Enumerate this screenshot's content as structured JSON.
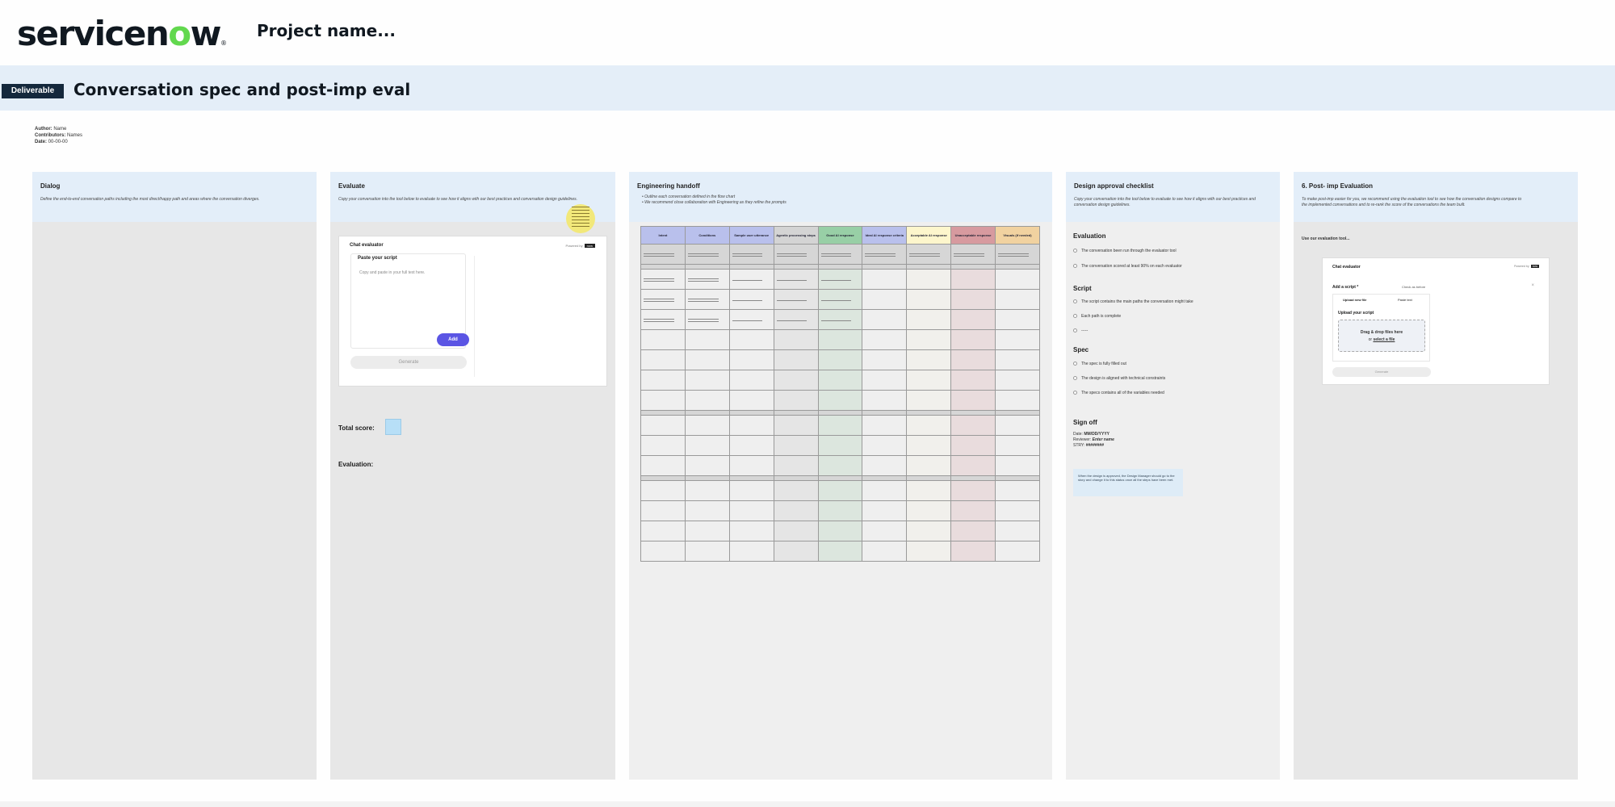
{
  "header": {
    "logo_text_a": "servicen",
    "logo_text_o": "o",
    "logo_text_b": "w",
    "logo_reg": "®",
    "project_name": "Project name..."
  },
  "deliverable": {
    "badge": "Deliverable",
    "title": "Conversation spec and post-imp eval"
  },
  "meta": {
    "author_label": "Author:",
    "author_value": " Name",
    "contributors_label": "Contributors:",
    "contributors_value": " Names",
    "date_label": "Date:",
    "date_value": " 00-00-00"
  },
  "columns": {
    "dialog": {
      "title": "Dialog",
      "desc": "Define the end-to-end conversation paths including the most direct/happy path and areas where the conversation diverges."
    },
    "evaluate": {
      "title": "Evaluate",
      "desc": "Copy your conversation into the tool below to evaluate to see how it aligns with our best practices and conversation design guidelines.",
      "card_title": "Chat evaluator",
      "card_right_text": "Powered by",
      "card_right_badge": "now",
      "paste_label": "Paste your script",
      "paste_placeholder": "Copy and paste in your full text here.",
      "add_button": "Add",
      "generate_button": "Generate",
      "total_score_label": "Total score:",
      "evaluation_label": "Evaluation:"
    },
    "handoff": {
      "title": "Engineering handoff",
      "bullets": [
        "•  Outline each conversation defined in the flow chart",
        "•  We recommend close collaboration with Engineering as they refine the prompts"
      ],
      "headers": [
        "Intent",
        "Conditions",
        "Sample user utterance",
        "Agentic processing steps",
        "Good AI response",
        "Ideal AI response criteria",
        "Acceptable AI response",
        "Unacceptable response",
        "Visuals (if needed)"
      ],
      "header_colors": [
        "#b9c0ec",
        "#b9c0ec",
        "#b9c0ec",
        "#d4d4d4",
        "#98cfa6",
        "#b9c0ec",
        "#fdf6cc",
        "#d79a9f",
        "#f1d2a0"
      ]
    },
    "checklist": {
      "title": "Design approval checklist",
      "desc": "Copy your conversation into the tool below to evaluate to see how it aligns with our best practices and conversation design guidelines.",
      "sections": [
        {
          "name": "Evaluation",
          "items": [
            "The conversation been run through the evaluator tool",
            "The conversation scored at least 90% on each evaluator"
          ]
        },
        {
          "name": "Script",
          "items": [
            "The script contains the main paths the conversation might take",
            "Each path is complete",
            "-----"
          ]
        },
        {
          "name": "Spec",
          "items": [
            "The spec is fully filled out",
            "The design is aligned with technical constraints",
            "The specs contains all of the variables needed"
          ]
        }
      ],
      "signoff_title": "Sign off",
      "signoff_date_label": "Date: ",
      "signoff_date_value": "MM/DD/YYYY",
      "signoff_reviewer_label": "Reviewer: ",
      "signoff_reviewer_value": "Enter name",
      "signoff_stry_label": "STRY: ",
      "signoff_stry_value": "########",
      "note": "When the design is approved, the Design Manager should go to the story and change it to this status once all the steps have been met."
    },
    "postimp": {
      "title": "6. Post- imp Evaluation",
      "desc": "To make post-imp easier for you, we recommend using the evaluation tool to see how the conversation designs compare to the implemented conversations and to re-rank the score of the conversations the team built.",
      "use_tool": "Use our evaluation tool...",
      "card_title": "Chat evaluator",
      "card_right_text": "Powered by",
      "card_right_badge": "now",
      "add_script": "Add a script *",
      "check_text": "Check as before",
      "close": "×",
      "tab_upload": "Upload new file",
      "tab_paste": "Paste text",
      "upload_label": "Upload your script",
      "drop_line1": "Drag & drop files here",
      "drop_or": "or ",
      "drop_link": "select a file",
      "generate_button": "Generate"
    }
  }
}
